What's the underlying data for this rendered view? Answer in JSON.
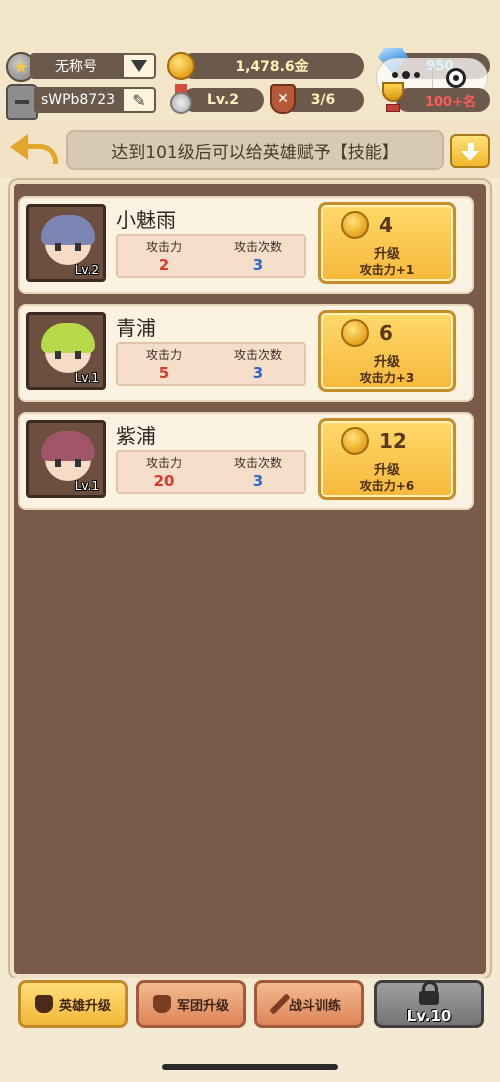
{
  "top": {
    "title_name": "无称号",
    "player_id": "sWPb8723",
    "gold": "1,478.6金",
    "level": "Lv.2",
    "battle": "3/6",
    "gems": "950",
    "rank": "100+名"
  },
  "banner": {
    "notice": "达到101级后可以给英雄赋予【技能】"
  },
  "stat_labels": {
    "attack": "攻击力",
    "hits": "攻击次数"
  },
  "heroes": [
    {
      "name": "小魅雨",
      "level": "Lv.2",
      "attack": "2",
      "hits": "3",
      "cost": "4",
      "upgrade_label": "升级",
      "bonus": "攻击力+1",
      "hair_color": "#7b86b4"
    },
    {
      "name": "青浦",
      "level": "Lv.1",
      "attack": "5",
      "hits": "3",
      "cost": "6",
      "upgrade_label": "升级",
      "bonus": "攻击力+3",
      "hair_color": "#b8d94a"
    },
    {
      "name": "紫浦",
      "level": "Lv.1",
      "attack": "20",
      "hits": "3",
      "cost": "12",
      "upgrade_label": "升级",
      "bonus": "攻击力+6",
      "hair_color": "#a05568"
    }
  ],
  "tabs": [
    {
      "label": "英雄升级",
      "active": true
    },
    {
      "label": "军团升级",
      "active": false
    },
    {
      "label": "战斗训练",
      "active": false
    },
    {
      "label": "Lv.10",
      "locked": true
    }
  ],
  "colors": {
    "accent": "#f2b737",
    "panel": "#7a5a48",
    "attack_value": "#d83a2c",
    "hits_value": "#3266c6"
  }
}
